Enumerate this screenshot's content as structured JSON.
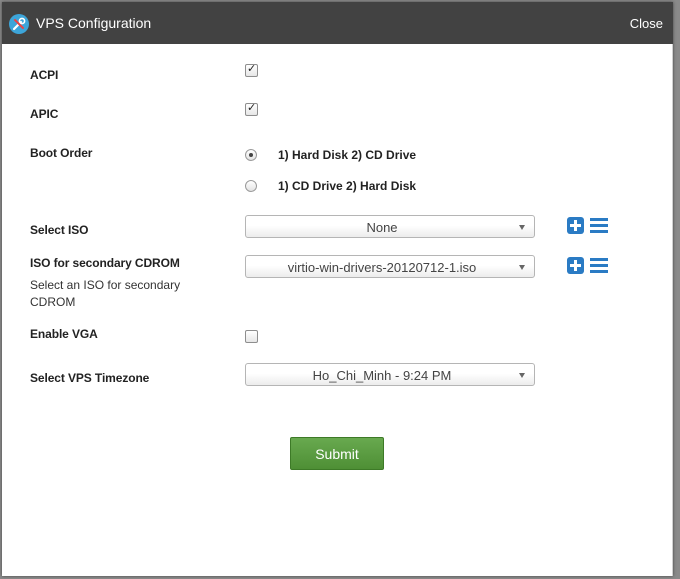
{
  "dialog": {
    "title": "VPS Configuration",
    "close_label": "Close",
    "title_icon": "tools-icon"
  },
  "form": {
    "acpi": {
      "label": "ACPI",
      "checked": true
    },
    "apic": {
      "label": "APIC",
      "checked": true
    },
    "boot_order": {
      "label": "Boot Order",
      "options": [
        {
          "label": "1) Hard Disk 2) CD Drive",
          "selected": true
        },
        {
          "label": "1) CD Drive 2) Hard Disk",
          "selected": false
        }
      ]
    },
    "select_iso": {
      "label": "Select ISO",
      "value": "None"
    },
    "secondary_cdrom": {
      "label": "ISO for secondary CDROM",
      "hint": "Select an ISO for secondary CDROM",
      "value": "virtio-win-drivers-20120712-1.iso"
    },
    "enable_vga": {
      "label": "Enable VGA",
      "checked": false
    },
    "timezone": {
      "label": "Select VPS Timezone",
      "value": "Ho_Chi_Minh - 9:24 PM"
    },
    "submit_label": "Submit"
  },
  "colors": {
    "titlebar": "#424242",
    "accent_blue": "#2a7bc4",
    "submit_green": "#5a9c40"
  }
}
